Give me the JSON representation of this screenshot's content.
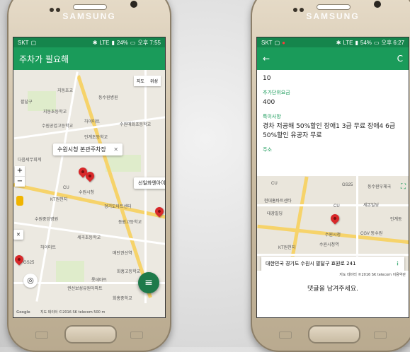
{
  "colors": {
    "app_green": "#1a9b5a",
    "status_green": "#15854c",
    "pin_red": "#d8282a",
    "fab_green": "#1e7a4a"
  },
  "left": {
    "brand": "SAMSUNG",
    "status": {
      "carrier": "SKT",
      "network": "LTE",
      "battery": "24%",
      "time": "오후 7:55"
    },
    "app_title": "주차가 필요해",
    "map_toggle": {
      "map": "지도",
      "satellite": "위성"
    },
    "zoom_in": "+",
    "zoom_out": "−",
    "callout_main": "수원시청 본관주차장",
    "callout_close": "✕",
    "callout_side": "선일화엔아이",
    "side_chip": "✕",
    "map_labels": {
      "l1": "지동초교",
      "l2": "동수원병원",
      "l3": "팔달구",
      "l4": "지동초등학교",
      "l5": "수원공업고등학교",
      "l6": "하이마트",
      "l7": "수원매화초등학교",
      "l8": "인계초등학교",
      "l9": "수원시청",
      "l10": "KT원천지",
      "l11": "수원중앙병원",
      "l12": "경기도아트센터",
      "l13": "매탄권선역",
      "l14": "세곡초등학교",
      "l15": "GS25",
      "l16": "화홍고등학교",
      "l17": "롯데마트",
      "l18": "권선보성유원아파트",
      "l19": "화홍중학교",
      "l20": "다음세무회계",
      "l21": "CU",
      "l22": "하이마트",
      "l23": "동원고등학교"
    },
    "attribution": "지도 데이터 ©2016 SK telecom   500 m",
    "google": "Google"
  },
  "right": {
    "brand": "SAMSUNG",
    "status": {
      "carrier": "SKT",
      "network": "LTE",
      "battery": "54%",
      "time": "오후 6:27"
    },
    "back_icon": "←",
    "refresh_icon": "C",
    "value_top": "10",
    "label_extra_fee": "추가단위요금",
    "value_extra_fee": "400",
    "label_special": "특이사항",
    "value_special": "경차 저공해 50%할인 장애1 3급 무료 장애4 6급50%할인 유공자 무료",
    "label_address": "주소",
    "address": "대한민국 경기도 수원시 팔달구 효원로 241",
    "address_more": "⋮",
    "map_labels": {
      "r1": "CU",
      "r2": "GS25",
      "r3": "동수원우체국",
      "r4": "현대홈바트센타",
      "r5": "세본빌딩",
      "r6": "수원시청",
      "r7": "CGV 동수원",
      "r8": "CU",
      "r9": "인계동",
      "r10": "KT원천지",
      "r11": "수원시청역",
      "r12": "대광빌딩"
    },
    "attribution": "지도 데이터 ©2016 SK telecom  이용약관",
    "comment": "댓글을 남겨주세요."
  }
}
